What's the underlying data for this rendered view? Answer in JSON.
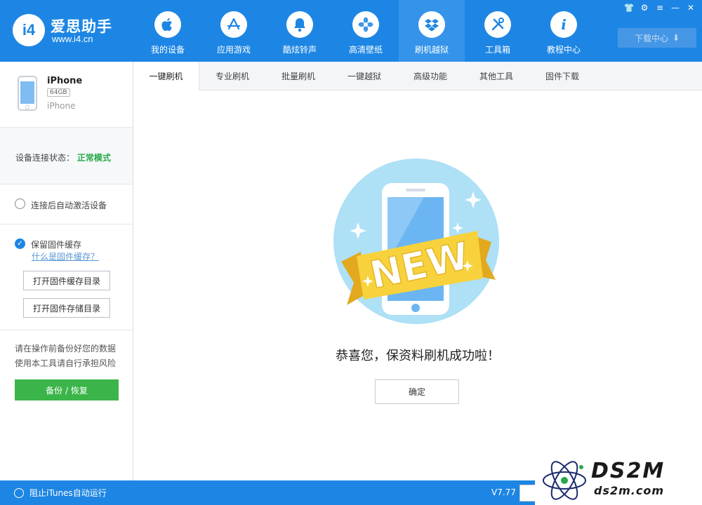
{
  "app": {
    "title": "爱思助手",
    "url": "www.i4.cn",
    "logo_text": "i4"
  },
  "nav": [
    {
      "label": "我的设备",
      "icon": "apple-icon",
      "glyph": ""
    },
    {
      "label": "应用游戏",
      "icon": "app-store-icon",
      "glyph": "A"
    },
    {
      "label": "酷炫铃声",
      "icon": "bell-icon",
      "glyph": "🔔"
    },
    {
      "label": "高清壁纸",
      "icon": "flower-icon",
      "glyph": "❀"
    },
    {
      "label": "刷机越狱",
      "icon": "dropbox-icon",
      "glyph": "◈",
      "active": true
    },
    {
      "label": "工具箱",
      "icon": "tools-icon",
      "glyph": "✂"
    },
    {
      "label": "教程中心",
      "icon": "info-icon",
      "glyph": "i"
    }
  ],
  "window_controls": {
    "skin": "👕",
    "settings": "⚙",
    "menu": "≡",
    "minimize": "—",
    "close": "✕"
  },
  "download_center": {
    "label": "下载中心",
    "icon": "⬇"
  },
  "device": {
    "name": "iPhone",
    "capacity": "64GB",
    "model": "iPhone"
  },
  "connection": {
    "label": "设备连接状态：",
    "value": "正常模式"
  },
  "options": {
    "auto_activate": "连接后自动激活设备",
    "keep_cache": "保留固件缓存",
    "what_is_cache": "什么是固件缓存？",
    "open_cache_dir": "打开固件缓存目录",
    "open_storage_dir": "打开固件存储目录"
  },
  "backup": {
    "warning_line1": "请在操作前备份好您的数据",
    "warning_line2": "使用本工具请自行承担风险",
    "button": "备份 / 恢复"
  },
  "tabs": [
    "一键刷机",
    "专业刷机",
    "批量刷机",
    "一键越狱",
    "高级功能",
    "其他工具",
    "固件下载"
  ],
  "active_tab": 0,
  "content": {
    "badge": "NEW",
    "message": "恭喜您，保资料刷机成功啦！",
    "ok_button": "确定"
  },
  "statusbar": {
    "itunes": "阻止iTunes自动运行",
    "version": "V7.77"
  },
  "watermark": {
    "main": "DS2M",
    "sub": "ds2m.com"
  },
  "colors": {
    "primary": "#1d86e4",
    "success": "#3bb54a",
    "status_ok": "#2aa84a",
    "ribbon": "#f7d23c"
  }
}
